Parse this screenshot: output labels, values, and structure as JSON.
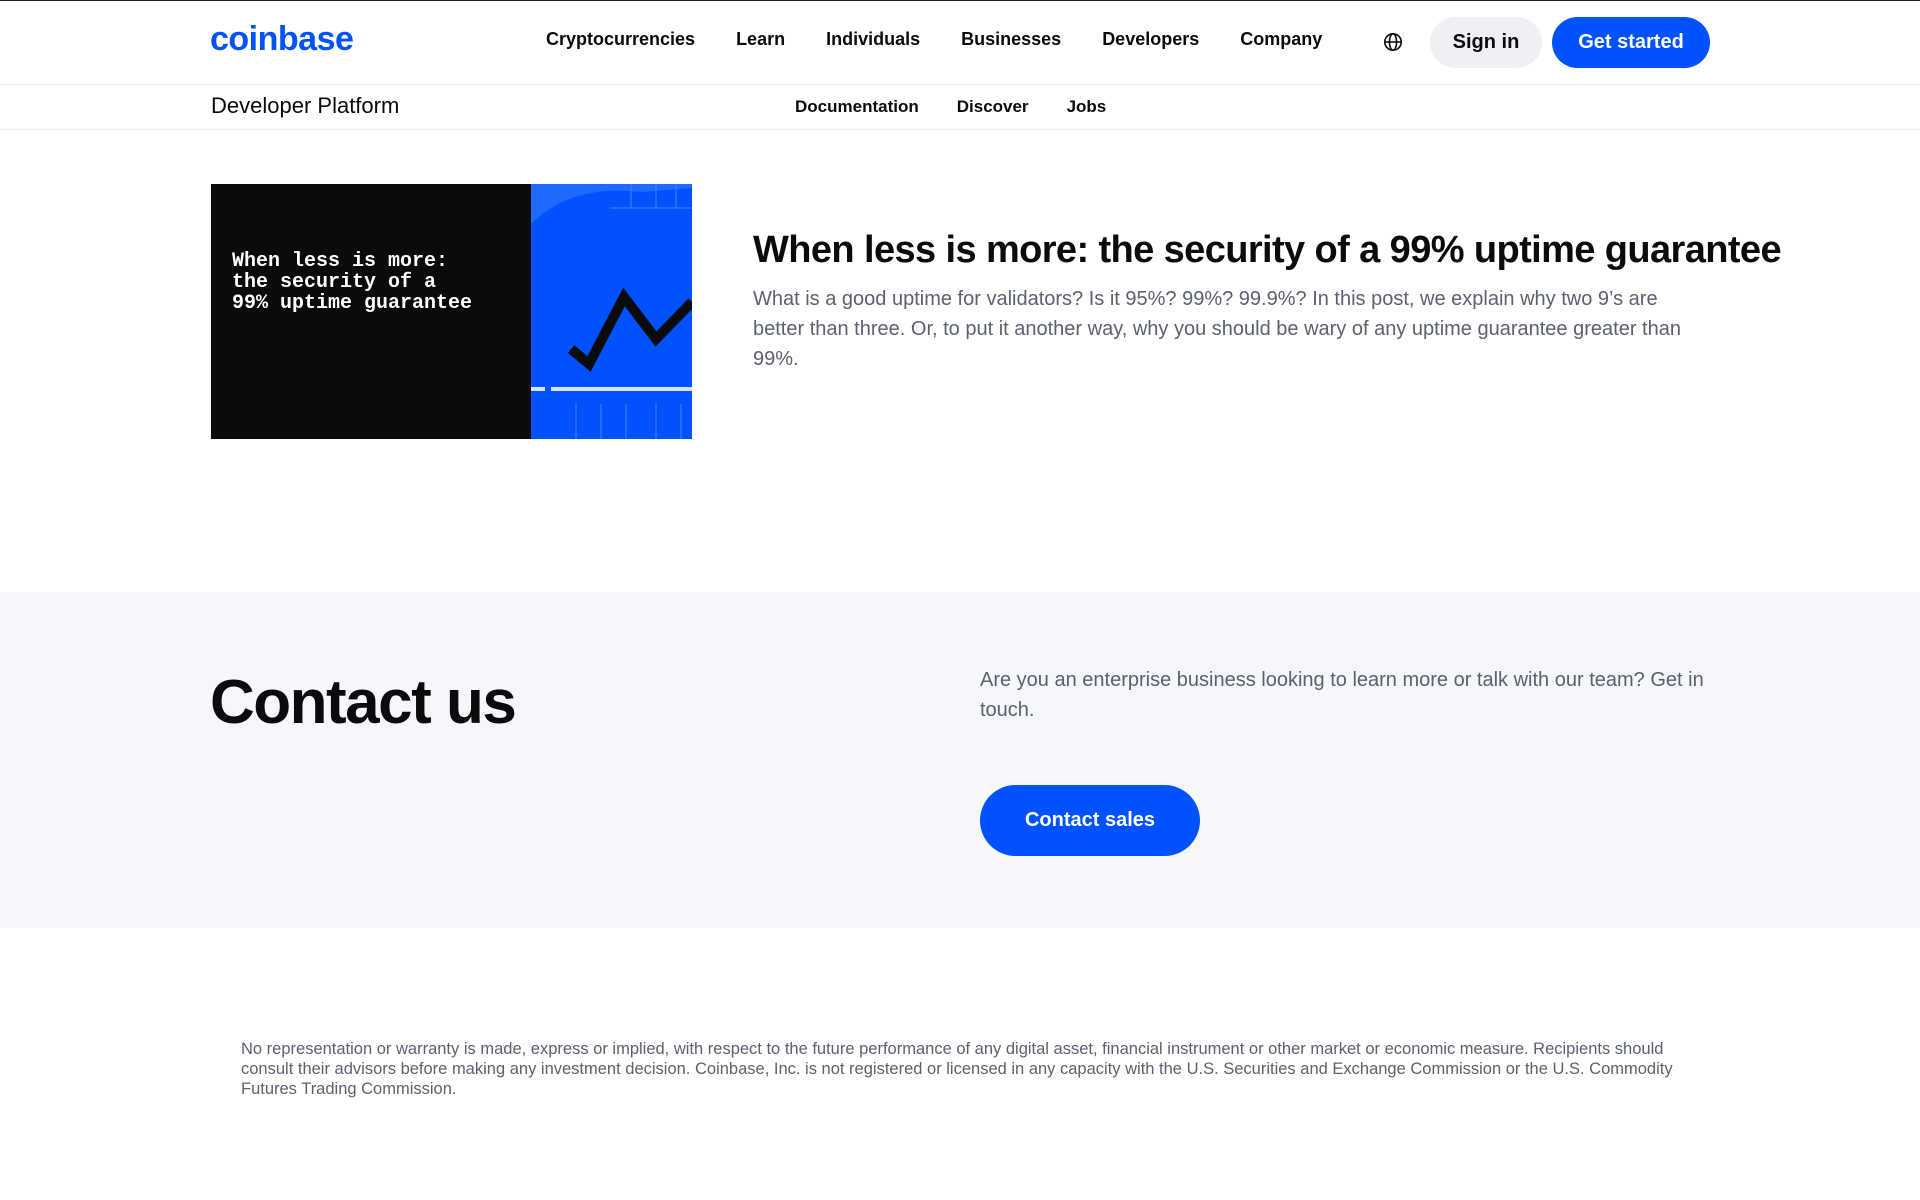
{
  "header": {
    "logo_text": "coinbase",
    "nav": [
      "Cryptocurrencies",
      "Learn",
      "Individuals",
      "Businesses",
      "Developers",
      "Company"
    ],
    "language_icon": "globe-icon",
    "sign_in_label": "Sign in",
    "get_started_label": "Get started"
  },
  "subnav": {
    "title": "Developer Platform",
    "links": [
      "Documentation",
      "Discover",
      "Jobs"
    ]
  },
  "article": {
    "thumbnail_text": "When less is more:\nthe security of a\n99% uptime guarantee",
    "title": "When less is more: the security of a 99% uptime guarantee",
    "description": "What is a good uptime for validators? Is it 95%? 99%? 99.9%? In this post, we explain why two 9’s are better than three. Or, to put it another way, why you should be wary of any uptime guarantee greater than 99%."
  },
  "contact": {
    "title": "Contact us",
    "description": "Are you an enterprise business looking to learn more or talk with our team? Get in touch.",
    "button_label": "Contact sales"
  },
  "disclaimer": "No representation or warranty is made, express or implied, with respect to the future performance of any digital asset, financial instrument or other market or economic measure. Recipients should consult their advisors before making any investment decision. Coinbase, Inc. is not registered or licensed in any capacity with the U.S. Securities and Exchange Commission or the U.S. Commodity Futures Trading Commission.",
  "colors": {
    "brand_blue": "#0052ff",
    "text_primary": "#0a0b0d",
    "text_secondary": "#5b616e",
    "section_bg": "#f5f7fb"
  }
}
